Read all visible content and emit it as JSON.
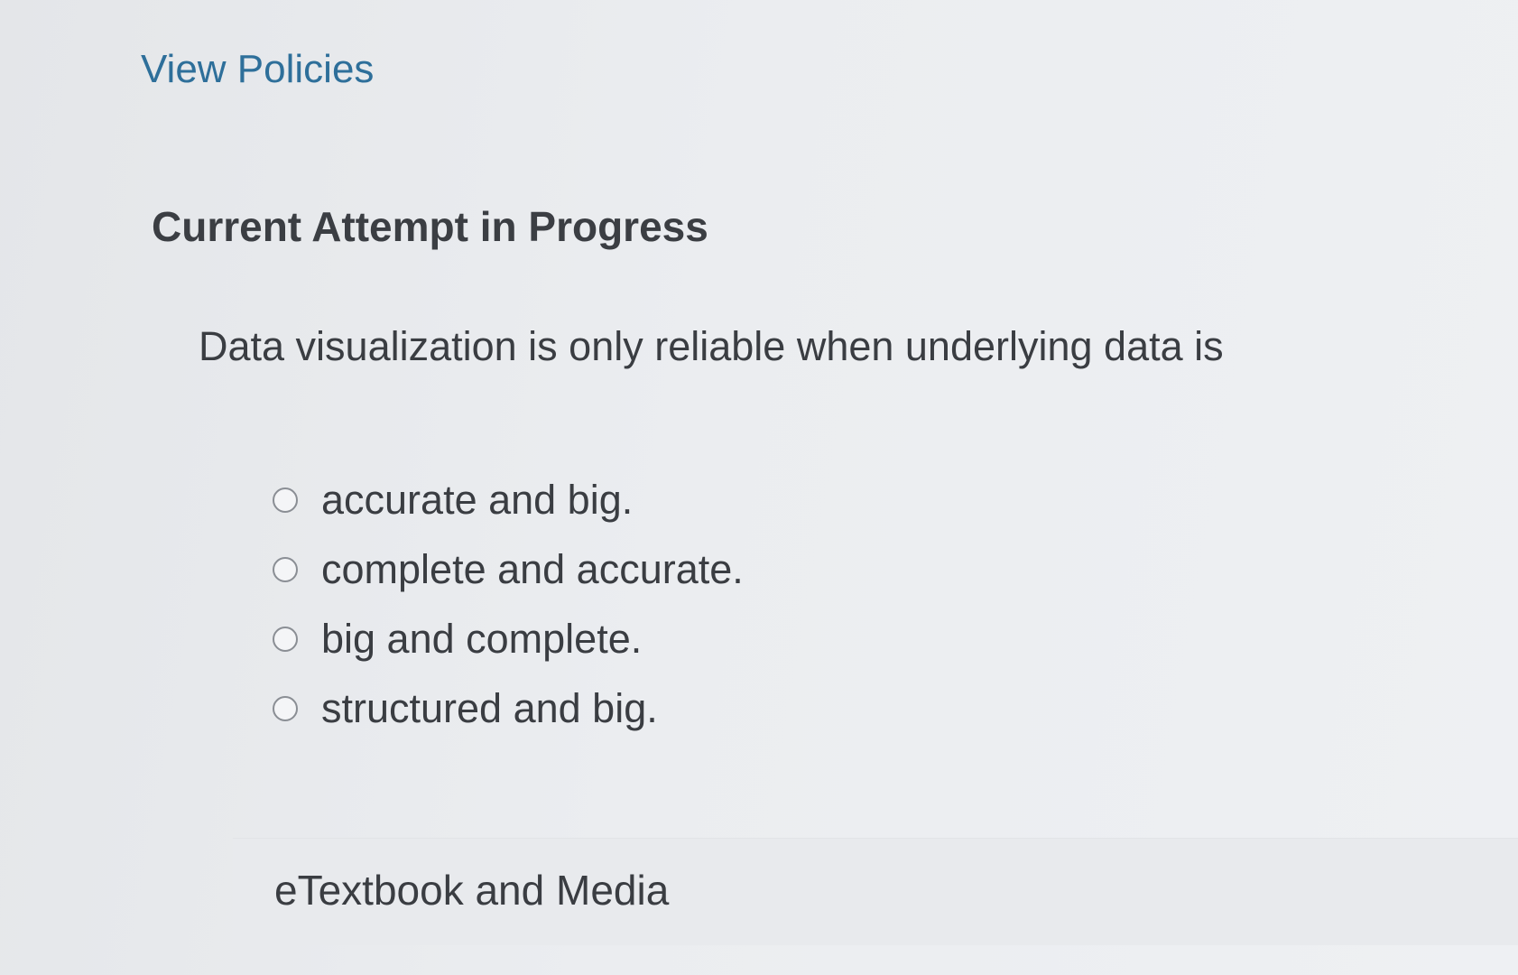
{
  "header": {
    "view_policies": "View Policies"
  },
  "attempt": {
    "heading": "Current Attempt in Progress"
  },
  "question": {
    "text": "Data visualization is only reliable when underlying data is",
    "options": [
      {
        "label": "accurate and big.",
        "selected": false
      },
      {
        "label": "complete and accurate.",
        "selected": false
      },
      {
        "label": "big and complete.",
        "selected": false
      },
      {
        "label": "structured and big.",
        "selected": false
      }
    ]
  },
  "resources": {
    "etextbook_label": "eTextbook and Media"
  },
  "colors": {
    "link": "#2e6f9a",
    "text": "#3a3d42",
    "background": "#eceef1"
  }
}
